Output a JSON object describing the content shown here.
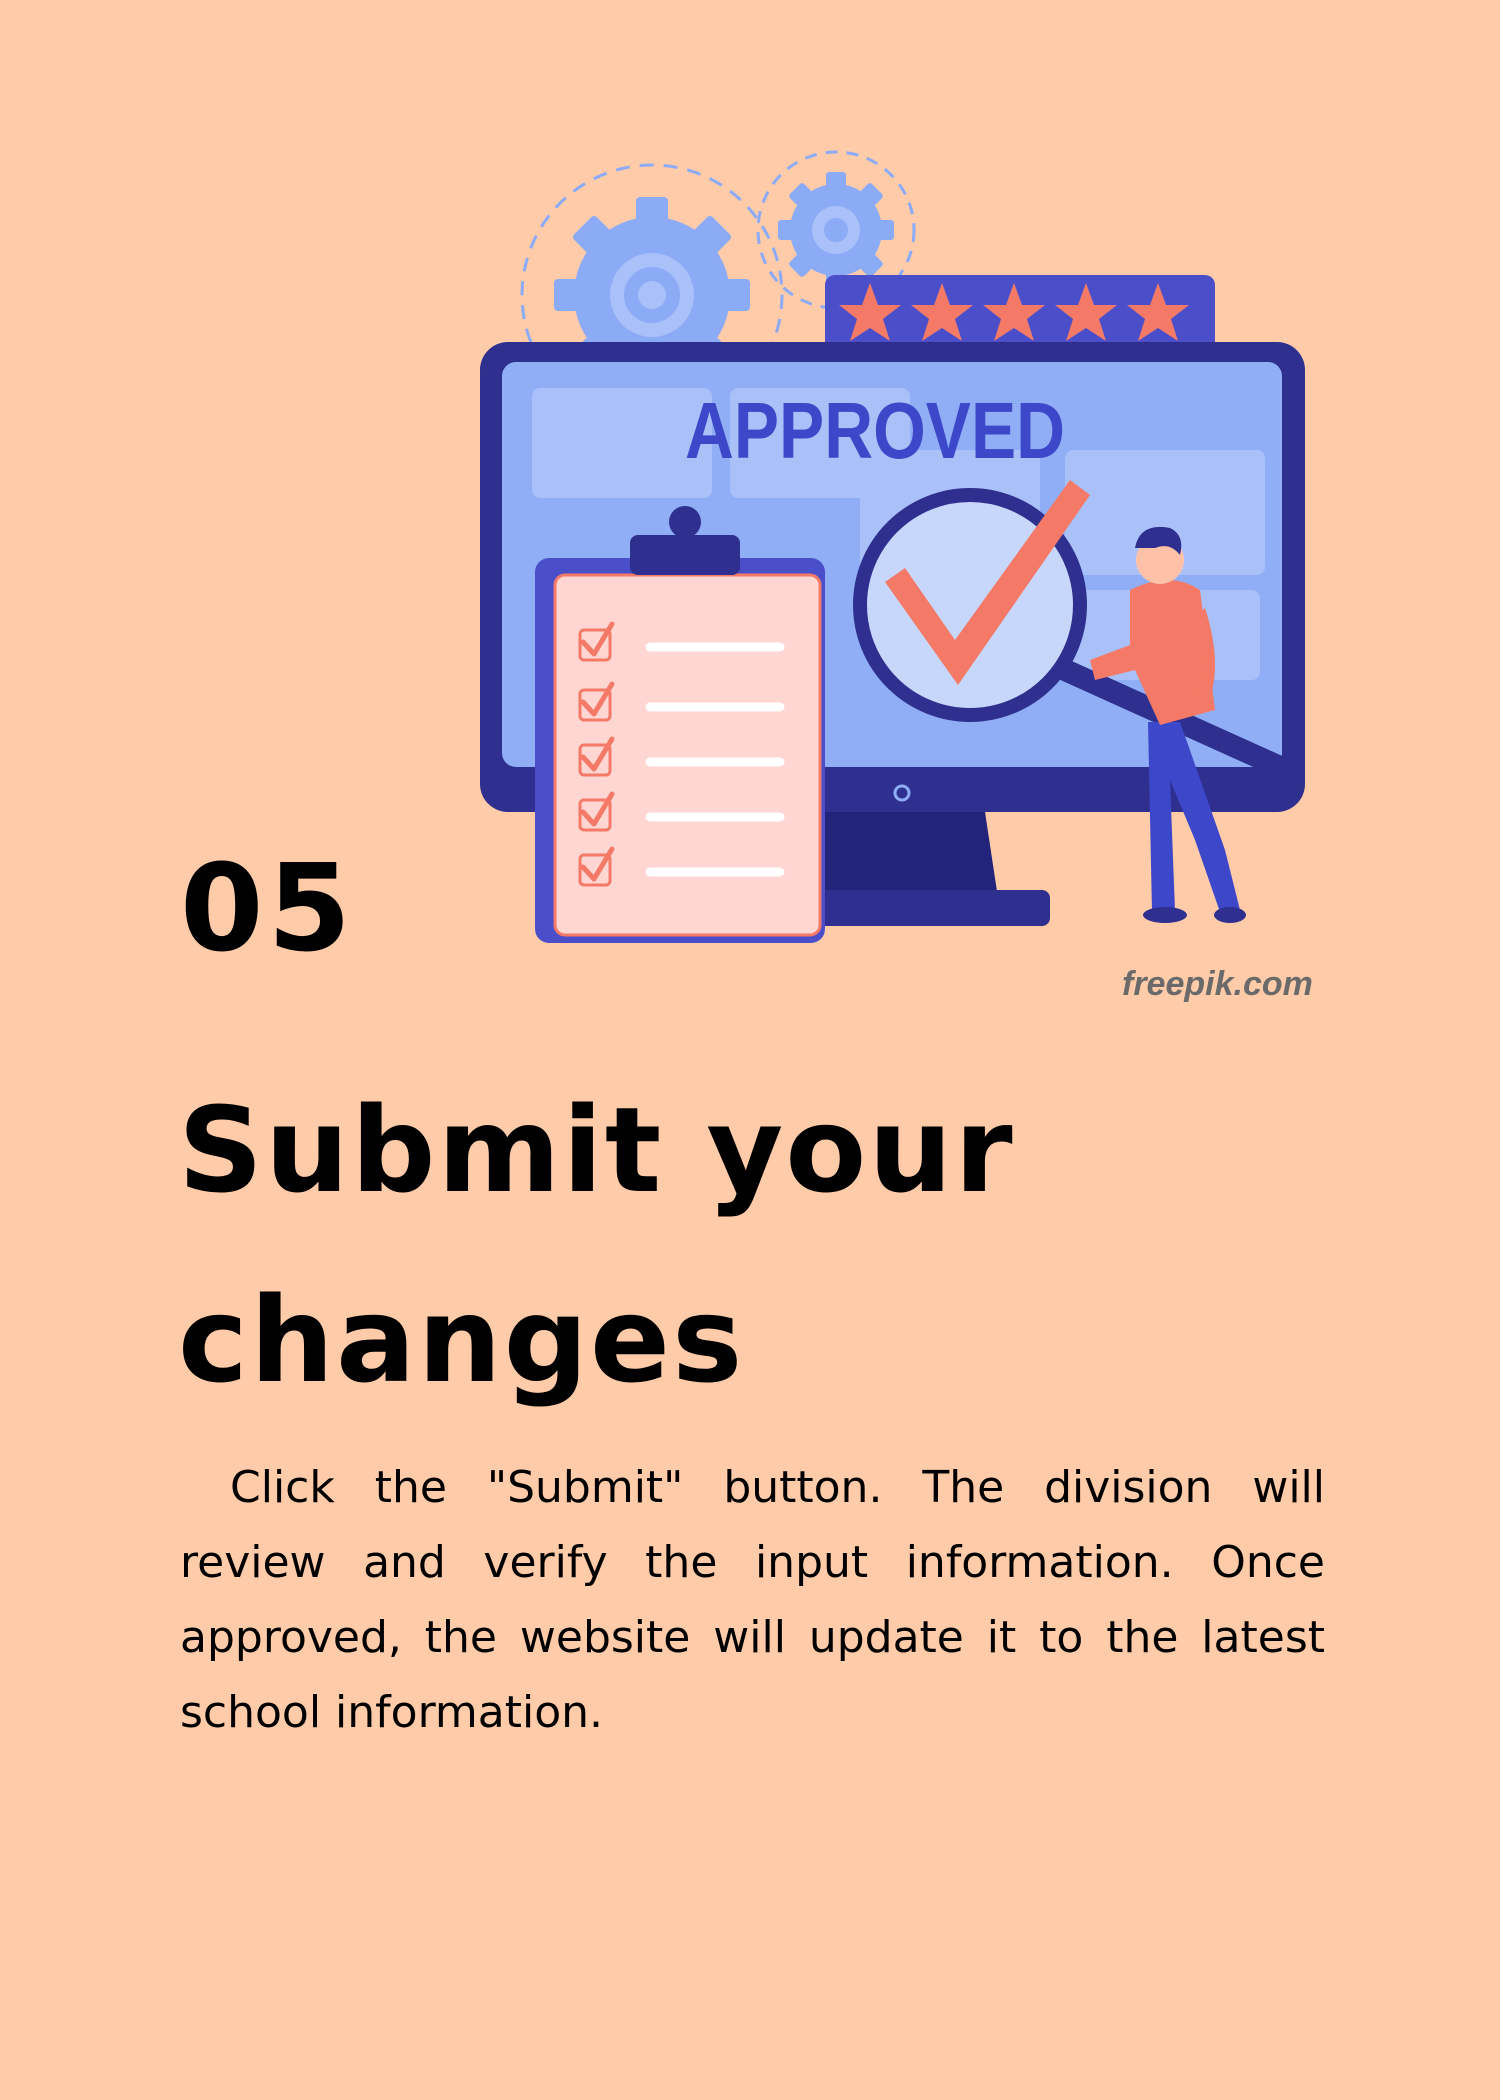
{
  "illustration": {
    "screen_text": "APPROVED",
    "rating_stars": 5,
    "checklist_items": 5,
    "colors": {
      "background": "#ffcba8",
      "monitor": "#2e2f8f",
      "screen": "#8faef5",
      "accent": "#f47a67",
      "approved_text": "#3d47c9",
      "gear": "#8cabf6"
    }
  },
  "step": {
    "number": "05",
    "credit": "freepik.com",
    "title_line1": "Submit your",
    "title_line2": "changes",
    "description": "Click the \"Submit\" button. The division will review and verify the input information. Once approved, the website will update it to the latest school information."
  }
}
